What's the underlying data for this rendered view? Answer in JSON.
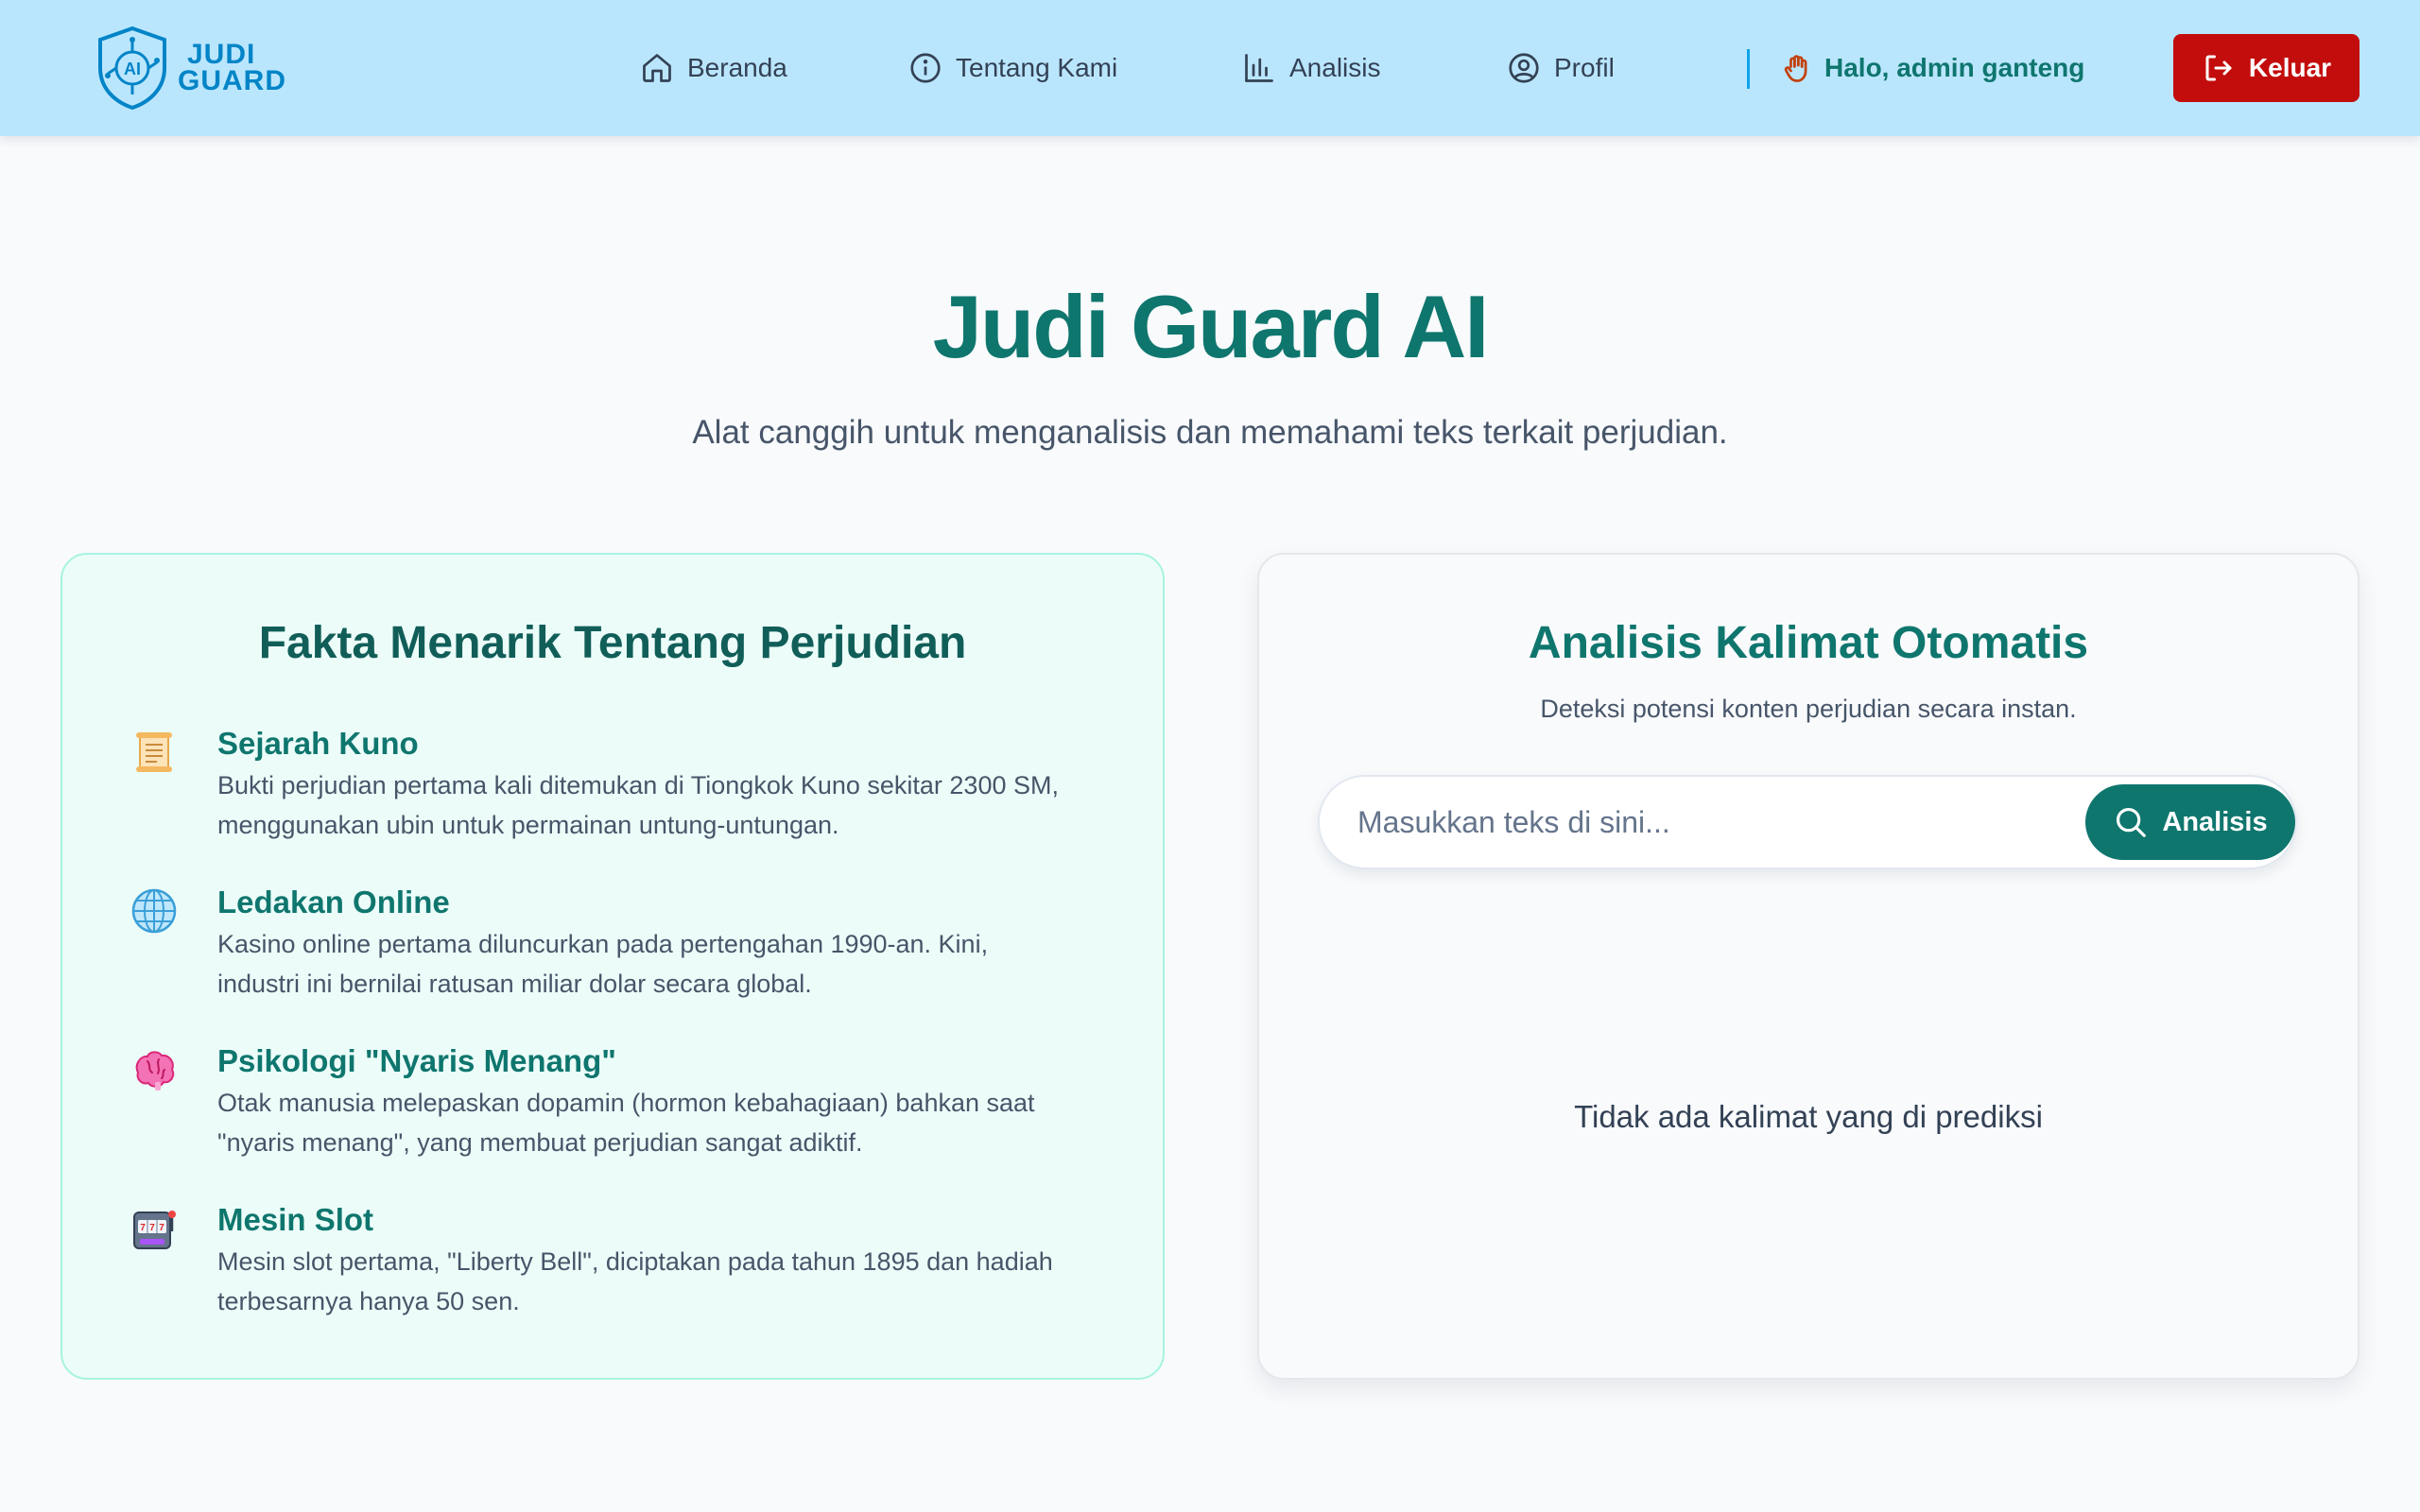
{
  "brand": {
    "line1": "JUDI",
    "line2": "GUARD",
    "badge": "AI"
  },
  "nav": {
    "items": [
      {
        "label": "Beranda",
        "icon": "home-icon"
      },
      {
        "label": "Tentang Kami",
        "icon": "info-icon"
      },
      {
        "label": "Analisis",
        "icon": "bar-chart-icon"
      },
      {
        "label": "Profil",
        "icon": "user-circle-icon"
      }
    ],
    "greeting": "Halo, admin ganteng",
    "greeting_icon": "waving-hand-icon",
    "logout_label": "Keluar",
    "logout_icon": "logout-icon"
  },
  "hero": {
    "title": "Judi Guard AI",
    "subtitle": "Alat canggih untuk menganalisis dan memahami teks terkait perjudian."
  },
  "facts": {
    "title": "Fakta Menarik Tentang Perjudian",
    "items": [
      {
        "icon": "scroll-icon",
        "title": "Sejarah Kuno",
        "line1": "Bukti perjudian pertama kali ditemukan di Tiongkok Kuno sekitar 2300 SM,",
        "line2": "menggunakan ubin untuk permainan untung-untungan."
      },
      {
        "icon": "globe-icon",
        "title": "Ledakan Online",
        "line1": "Kasino online pertama diluncurkan pada pertengahan 1990-an. Kini,",
        "line2": "industri ini bernilai ratusan miliar dolar secara global."
      },
      {
        "icon": "brain-icon",
        "title": "Psikologi \"Nyaris Menang\"",
        "line1": "Otak manusia melepaskan dopamin (hormon kebahagiaan) bahkan saat",
        "line2": "\"nyaris menang\", yang membuat perjudian sangat adiktif."
      },
      {
        "icon": "slot-machine-icon",
        "title": "Mesin Slot",
        "line1": "Mesin slot pertama, \"Liberty Bell\", diciptakan pada tahun 1895 dan hadiah",
        "line2": "terbesarnya hanya 50 sen."
      }
    ]
  },
  "analysis": {
    "title": "Analisis Kalimat Otomatis",
    "subtitle": "Deteksi potensi konten perjudian secara instan.",
    "input_placeholder": "Masukkan teks di sini...",
    "input_value": "",
    "button_label": "Analisis",
    "button_icon": "search-icon",
    "empty_message": "Tidak ada kalimat yang di prediksi"
  },
  "colors": {
    "navbar_bg": "#bae6fd",
    "primary": "#0f766e",
    "danger": "#c30d0d",
    "facts_bg": "#ecfdf9"
  }
}
